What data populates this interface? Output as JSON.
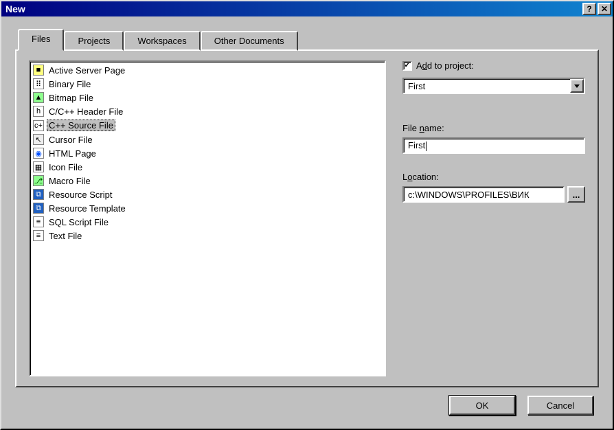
{
  "window": {
    "title": "New"
  },
  "tabs": [
    {
      "label": "Files",
      "active": true
    },
    {
      "label": "Projects",
      "active": false
    },
    {
      "label": "Workspaces",
      "active": false
    },
    {
      "label": "Other Documents",
      "active": false
    }
  ],
  "file_types": [
    {
      "icon": "asp",
      "label": "Active Server Page",
      "selected": false
    },
    {
      "icon": "bin",
      "label": "Binary File",
      "selected": false
    },
    {
      "icon": "bmp",
      "label": "Bitmap File",
      "selected": false
    },
    {
      "icon": "h",
      "label": "C/C++ Header File",
      "selected": false
    },
    {
      "icon": "cpp",
      "label": "C++ Source File",
      "selected": true
    },
    {
      "icon": "cur",
      "label": "Cursor File",
      "selected": false
    },
    {
      "icon": "html",
      "label": "HTML Page",
      "selected": false
    },
    {
      "icon": "ico",
      "label": "Icon File",
      "selected": false
    },
    {
      "icon": "macro",
      "label": "Macro File",
      "selected": false
    },
    {
      "icon": "res",
      "label": "Resource Script",
      "selected": false
    },
    {
      "icon": "res",
      "label": "Resource Template",
      "selected": false
    },
    {
      "icon": "txt",
      "label": "SQL Script File",
      "selected": false
    },
    {
      "icon": "txt",
      "label": "Text File",
      "selected": false
    }
  ],
  "icon_glyphs": {
    "asp": "■",
    "bin": "⠿",
    "bmp": "▲",
    "h": "h",
    "cpp": "c+",
    "cur": "↖",
    "html": "◉",
    "ico": "▦",
    "macro": "⎇",
    "res": "⧉",
    "txt": "≡"
  },
  "add_to_project": {
    "checked": true,
    "label_pre": "A",
    "label_underlined": "d",
    "label_post": "d to project:",
    "value": "First"
  },
  "file_name": {
    "label_pre": "File ",
    "label_underlined": "n",
    "label_post": "ame:",
    "value": "First"
  },
  "location": {
    "label_pre": "L",
    "label_underlined": "o",
    "label_post": "cation:",
    "value": "c:\\WINDOWS\\PROFILES\\ВИК",
    "browse_label": "..."
  },
  "buttons": {
    "ok": "OK",
    "cancel": "Cancel"
  },
  "titlebar_buttons": {
    "help": "?",
    "close": "✕"
  }
}
